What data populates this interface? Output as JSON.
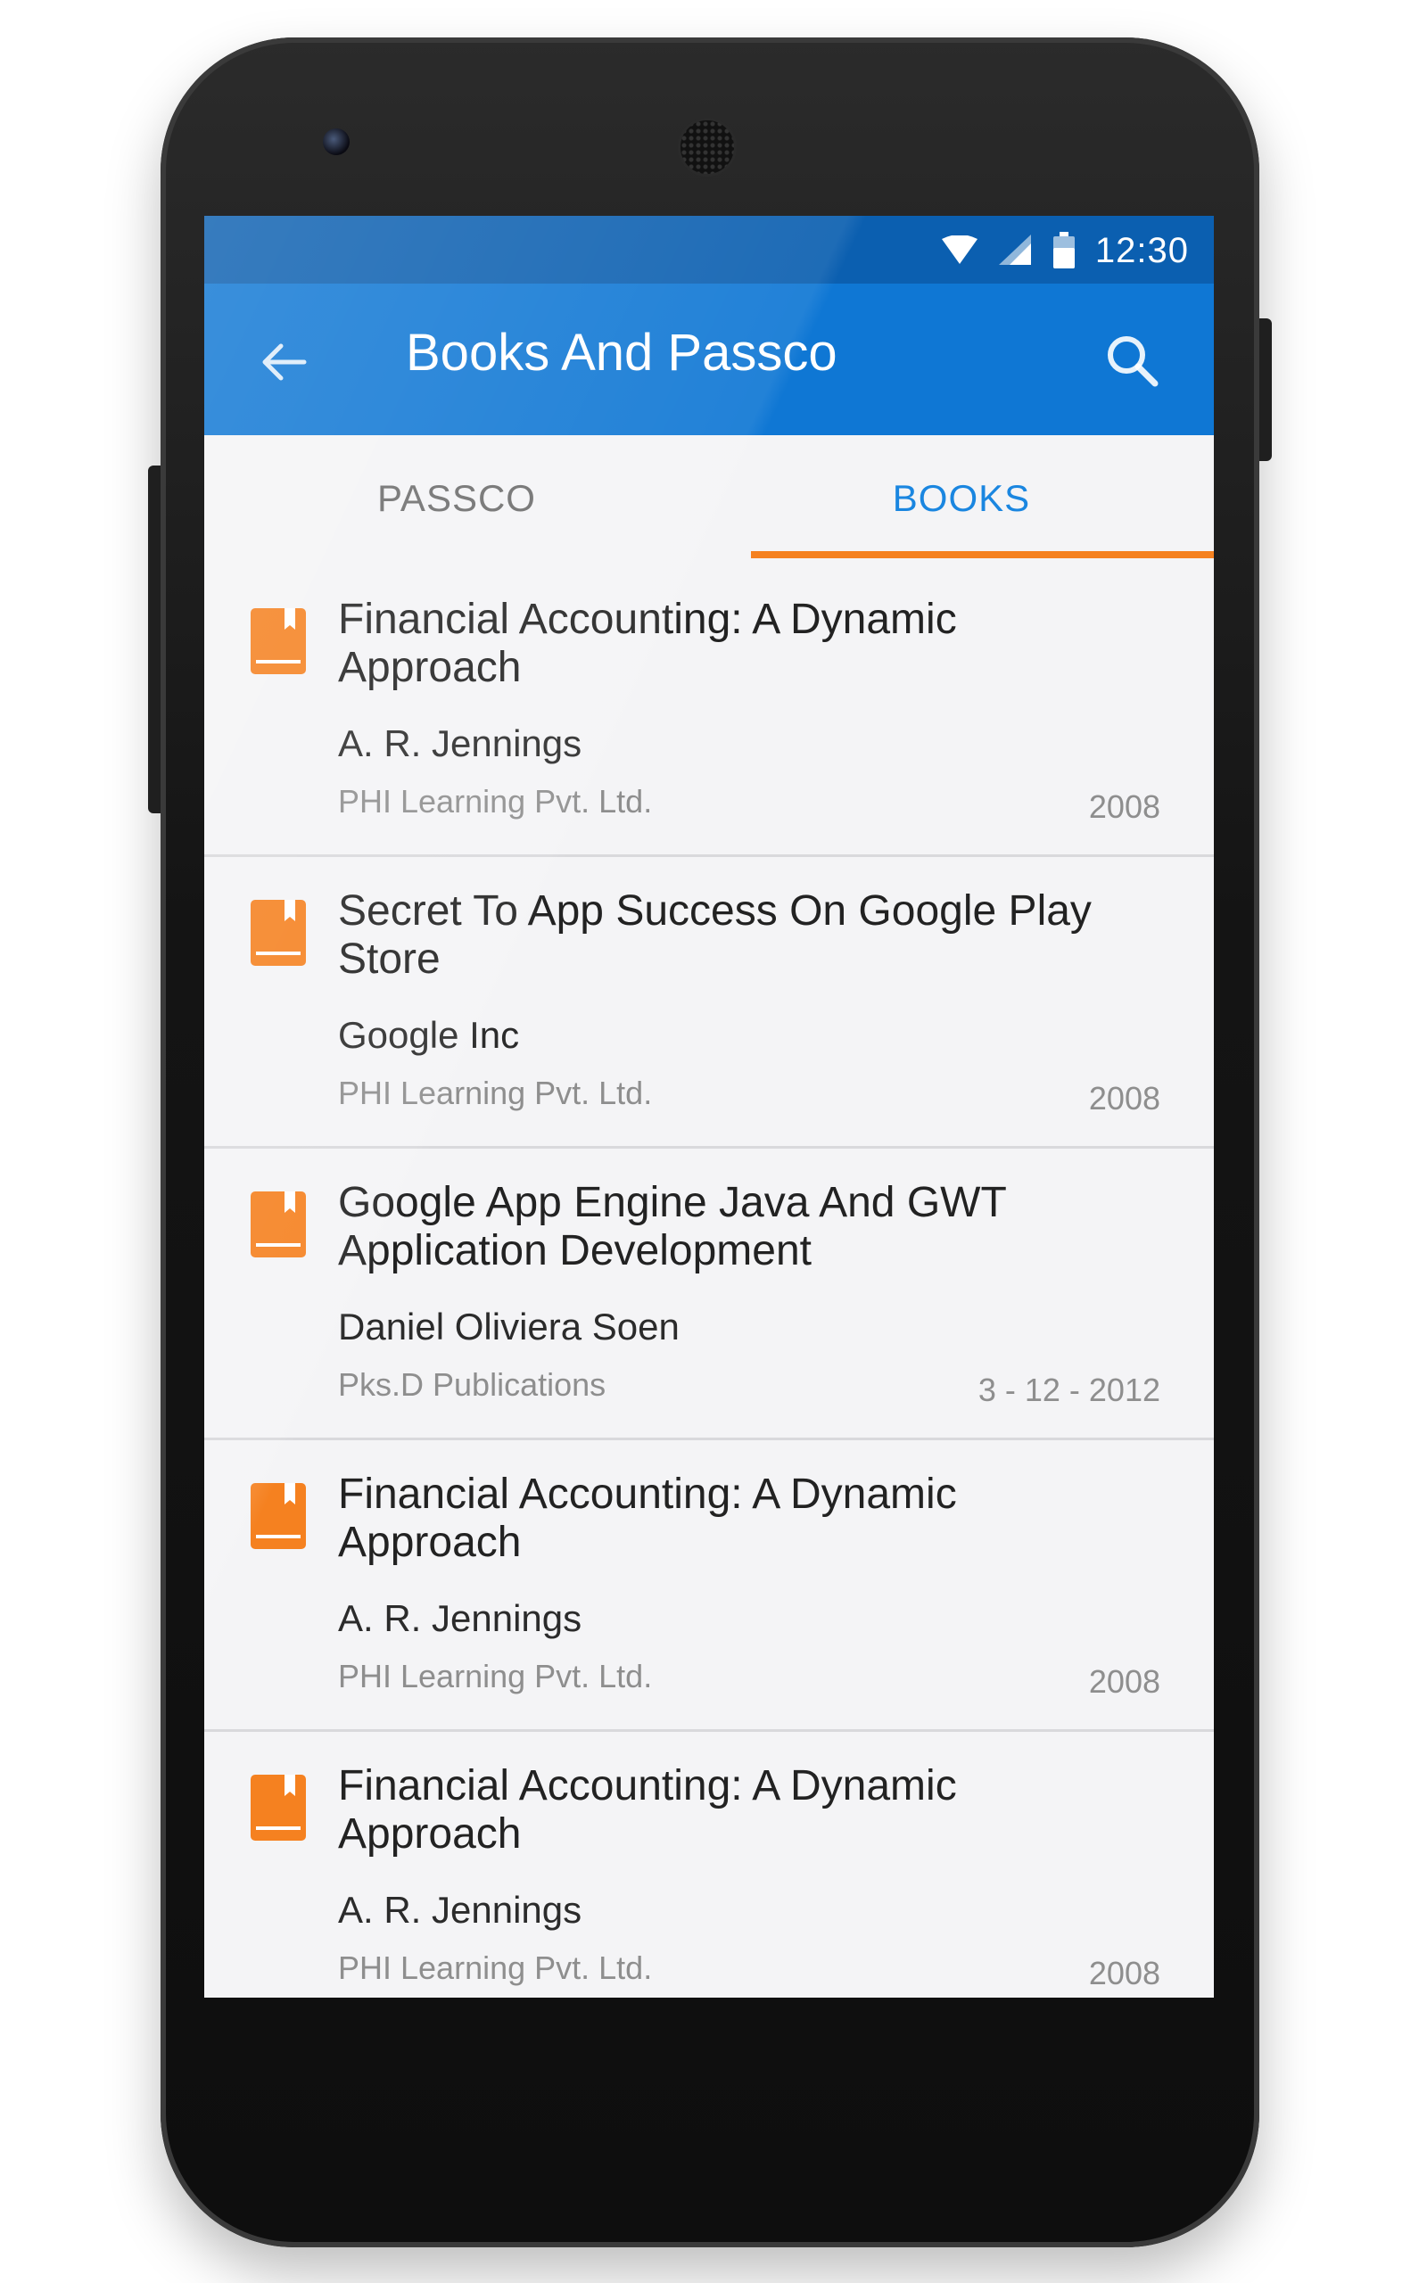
{
  "status_bar": {
    "time": "12:30"
  },
  "app_bar": {
    "title": "Books And Passco"
  },
  "tabs": [
    {
      "label": "PASSCO",
      "selected": false
    },
    {
      "label": "BOOKS",
      "selected": true
    }
  ],
  "books": [
    {
      "title": "Financial Accounting: A Dynamic Approach",
      "author": "A. R. Jennings",
      "publisher": "PHI Learning Pvt. Ltd.",
      "date": "2008"
    },
    {
      "title": "Secret To App Success On Google Play Store",
      "author": "Google Inc",
      "publisher": "PHI Learning Pvt. Ltd.",
      "date": "2008"
    },
    {
      "title": "Google App Engine Java And GWT Application Development",
      "author": "Daniel Oliviera Soen",
      "publisher": "Pks.D Publications",
      "date": "3 - 12 - 2012"
    },
    {
      "title": "Financial Accounting: A Dynamic Approach",
      "author": "A. R. Jennings",
      "publisher": "PHI Learning Pvt. Ltd.",
      "date": "2008"
    },
    {
      "title": "Financial Accounting: A Dynamic Approach",
      "author": "A. R. Jennings",
      "publisher": "PHI Learning Pvt. Ltd.",
      "date": "2008"
    }
  ],
  "colors": {
    "status_bar": "#0b5fb0",
    "app_bar": "#0f77d4",
    "accent": "#f58120",
    "selected_tab_text": "#1a86e0",
    "book_icon": "#f58120"
  }
}
